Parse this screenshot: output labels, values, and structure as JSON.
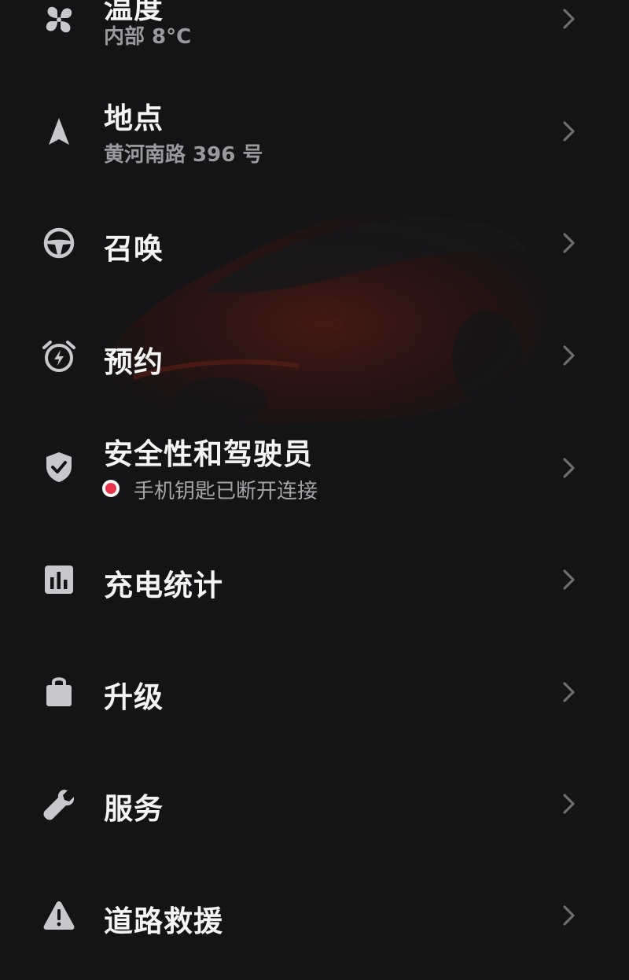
{
  "colors": {
    "background": "#141416",
    "text_primary": "#f4f4f4",
    "text_secondary": "#9a9a9e",
    "icon": "#c8c8cc",
    "chevron": "#6e6e72",
    "alert_dot": "#e8344a",
    "car_accent": "#8a2414"
  },
  "menu": {
    "items": [
      {
        "title": "温度",
        "subtitle": "内部 8°C",
        "icon": "fan-icon"
      },
      {
        "title": "地点",
        "subtitle": "黄河南路 396 号",
        "icon": "navigation-arrow-icon"
      },
      {
        "title": "召唤",
        "subtitle": "",
        "icon": "steering-wheel-icon"
      },
      {
        "title": "预约",
        "subtitle": "",
        "icon": "alarm-clock-bolt-icon"
      },
      {
        "title": "安全性和驾驶员",
        "subtitle": "手机钥匙已断开连接",
        "icon": "shield-check-icon",
        "status": "alert"
      },
      {
        "title": "充电统计",
        "subtitle": "",
        "icon": "bar-chart-icon"
      },
      {
        "title": "升级",
        "subtitle": "",
        "icon": "shopping-bag-icon"
      },
      {
        "title": "服务",
        "subtitle": "",
        "icon": "wrench-icon"
      },
      {
        "title": "道路救援",
        "subtitle": "",
        "icon": "warning-triangle-icon"
      }
    ]
  }
}
